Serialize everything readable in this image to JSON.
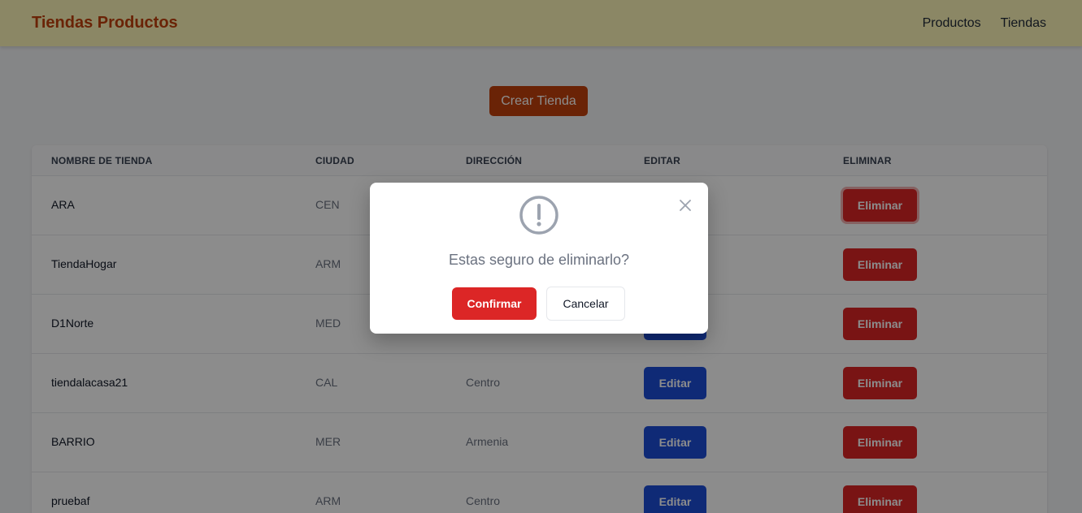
{
  "navbar": {
    "brand": "Tiendas Productos",
    "links": [
      "Productos",
      "Tiendas"
    ]
  },
  "create_button": "Crear Tienda",
  "table": {
    "headers": [
      "NOMBRE DE TIENDA",
      "CIUDAD",
      "DIRECCIÓN",
      "EDITAR",
      "ELIMINAR"
    ],
    "edit_label": "Editar",
    "delete_label": "Eliminar",
    "rows": [
      {
        "name": "ARA",
        "city": "CEN",
        "address": ""
      },
      {
        "name": "TiendaHogar",
        "city": "ARM",
        "address": ""
      },
      {
        "name": "D1Norte",
        "city": "MED",
        "address": ""
      },
      {
        "name": "tiendalacasa21",
        "city": "CAL",
        "address": "Centro"
      },
      {
        "name": "BARRIO",
        "city": "MER",
        "address": "Armenia"
      },
      {
        "name": "pruebaf",
        "city": "ARM",
        "address": "Centro"
      }
    ]
  },
  "modal": {
    "icon": "exclamation-circle-icon",
    "message": "Estas seguro de eliminarlo?",
    "confirm": "Confirmar",
    "cancel": "Cancelar",
    "close_icon": "close-icon"
  },
  "colors": {
    "navbar_bg": "#fdf6b9",
    "brand": "#c2410c",
    "create_button": "#c2410c",
    "edit_button": "#1d4ed8",
    "delete_button": "#dc2626",
    "confirm_button": "#dc2626"
  }
}
